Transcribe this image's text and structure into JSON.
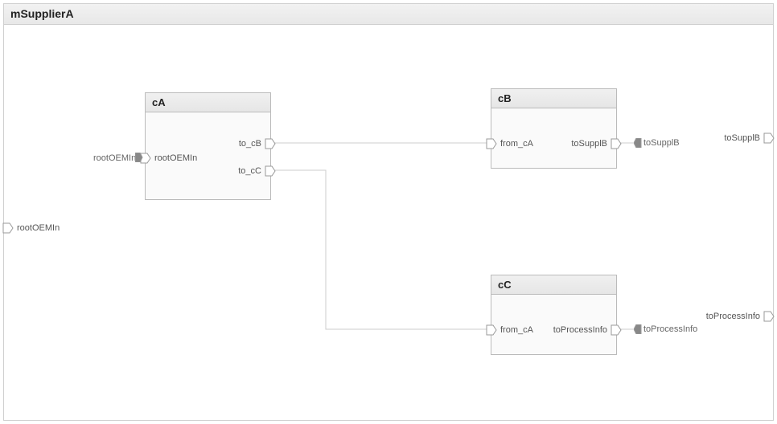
{
  "title": "mSupplierA",
  "framePorts": {
    "rootOEMIn": "rootOEMIn",
    "toSupplB": "toSupplB",
    "toProcessInfo": "toProcessInfo"
  },
  "blocks": {
    "cA": {
      "title": "cA",
      "inports": {
        "rootOEMIn": "rootOEMIn"
      },
      "outports": {
        "to_cB": "to_cB",
        "to_cC": "to_cC"
      }
    },
    "cB": {
      "title": "cB",
      "inports": {
        "from_cA": "from_cA"
      },
      "outports": {
        "toSupplB": "toSupplB"
      },
      "extLabels": {
        "toSupplB": "toSupplB"
      }
    },
    "cC": {
      "title": "cC",
      "inports": {
        "from_cA": "from_cA"
      },
      "outports": {
        "toProcessInfo": "toProcessInfo"
      },
      "extLabels": {
        "toProcessInfo": "toProcessInfo"
      }
    }
  },
  "extLabels": {
    "rootOEMIn": "rootOEMIn"
  }
}
